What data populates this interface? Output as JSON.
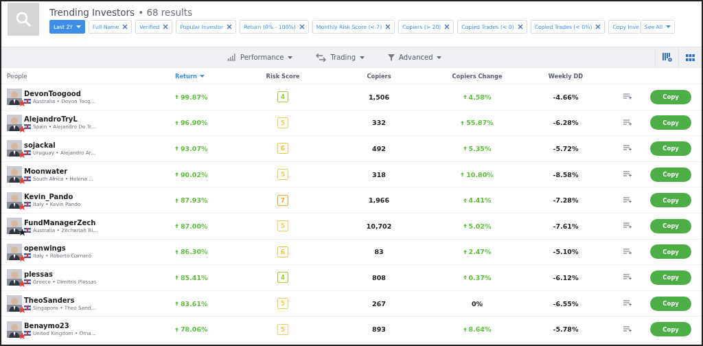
{
  "header": {
    "title": "Trending Investors",
    "count": "• 68 results"
  },
  "filters": [
    {
      "kind": "dropdown",
      "label": "Last 2Y",
      "selected": true
    },
    {
      "kind": "chip",
      "label": "Full Name"
    },
    {
      "kind": "chip",
      "label": "Verified"
    },
    {
      "kind": "chip",
      "label": "Popular Investor"
    },
    {
      "kind": "chip",
      "label": "Return (0% - 100%)"
    },
    {
      "kind": "chip",
      "label": "Monthly Risk Score (< 7)"
    },
    {
      "kind": "chip",
      "label": "Copiers (> 20)"
    },
    {
      "kind": "chip",
      "label": "Copied Trades (< 0)"
    },
    {
      "kind": "chip",
      "label": "Copied Trades (< 0%)"
    },
    {
      "kind": "cut",
      "label": "Copy Inve"
    },
    {
      "kind": "more",
      "label": "See All"
    }
  ],
  "toolbar": [
    {
      "kind": "chart",
      "label": "Performance"
    },
    {
      "kind": "swap",
      "label": "Trading"
    },
    {
      "kind": "filter",
      "label": "Advanced"
    }
  ],
  "table": {
    "columns": [
      {
        "label": "People",
        "sorted": false
      },
      {
        "label": "Return",
        "sorted": true
      },
      {
        "label": "Risk Score",
        "sorted": false
      },
      {
        "label": "Copiers",
        "sorted": false
      },
      {
        "label": "Copiers Change",
        "sorted": false
      },
      {
        "label": "Weekly DD",
        "sorted": false
      }
    ],
    "rows": [
      {
        "username": "DevonToogood",
        "subtitle": "Australia • Devon Toog...",
        "star": {
          "color": "#e53935"
        },
        "return": "99.87%",
        "risk": {
          "text": "4",
          "color": "#9ccc3c"
        },
        "copiers": "1,506",
        "change": {
          "kind": "up",
          "text": "4.58%"
        },
        "weekly_dd": "-4.66%",
        "action": "Copy"
      },
      {
        "username": "AlejandroTryL",
        "subtitle": "Spain • Alejandro De Tr...",
        "star": {
          "color": "#e53935"
        },
        "return": "96.90%",
        "risk": {
          "text": "5",
          "color": "#e9cf5a"
        },
        "copiers": "332",
        "change": {
          "kind": "up",
          "text": "55.87%"
        },
        "weekly_dd": "-6.28%",
        "action": "Copy"
      },
      {
        "username": "sojackal",
        "subtitle": "Uruguay • Alejandro Ar...",
        "star": {
          "color": "#e53935"
        },
        "return": "93.07%",
        "risk": {
          "text": "6",
          "color": "#f0c040"
        },
        "copiers": "492",
        "change": {
          "kind": "up",
          "text": "5.35%"
        },
        "weekly_dd": "-5.72%",
        "action": "Copy"
      },
      {
        "username": "Moonwater",
        "subtitle": "South Africa • Helena ...",
        "star": {
          "color": "#e53935"
        },
        "return": "90.02%",
        "risk": {
          "text": "5",
          "color": "#e9cf5a"
        },
        "copiers": "318",
        "change": {
          "kind": "up",
          "text": "10.80%"
        },
        "weekly_dd": "-8.58%",
        "action": "Copy"
      },
      {
        "username": "Kevin_Pando",
        "subtitle": "Italy • Kevin Pando",
        "star": {
          "color": "#e53935"
        },
        "return": "87.93%",
        "risk": {
          "text": "7",
          "color": "#f0a53a"
        },
        "copiers": "1,966",
        "change": {
          "kind": "up",
          "text": "4.41%"
        },
        "weekly_dd": "-7.28%",
        "action": "Copy"
      },
      {
        "username": "FundManagerZech",
        "subtitle": "Australia • Zechariah Bi...",
        "star": {
          "color": "#1a1a1a"
        },
        "return": "87.00%",
        "risk": {
          "text": "5",
          "color": "#e9cf5a"
        },
        "copiers": "10,702",
        "change": {
          "kind": "up",
          "text": "5.02%"
        },
        "weekly_dd": "-7.61%",
        "action": "Copy"
      },
      {
        "username": "openwings",
        "subtitle": "Italy • Roberto Garnero",
        "star": {
          "color": "#e53935"
        },
        "return": "86.30%",
        "risk": {
          "text": "6",
          "color": "#f0c040"
        },
        "copiers": "83",
        "change": {
          "kind": "up",
          "text": "2.47%"
        },
        "weekly_dd": "-5.10%",
        "action": "Copy"
      },
      {
        "username": "plessas",
        "subtitle": "Greece • Dimitris Plessas",
        "star": {
          "color": "#e53935"
        },
        "return": "85.41%",
        "risk": {
          "text": "4",
          "color": "#9ccc3c"
        },
        "copiers": "808",
        "change": {
          "kind": "up",
          "text": "0.37%"
        },
        "weekly_dd": "-6.12%",
        "action": "Copy"
      },
      {
        "username": "TheoSanders",
        "subtitle": "Singapore • Theo Sand...",
        "star": {
          "color": "#e53935"
        },
        "return": "83.61%",
        "risk": {
          "text": "5",
          "color": "#e9cf5a"
        },
        "copiers": "267",
        "change": {
          "kind": "flat",
          "text": "0%"
        },
        "weekly_dd": "-6.55%",
        "action": "Copy"
      },
      {
        "username": "Benaymo23",
        "subtitle": "United Kingdom • Oma...",
        "star": {
          "color": "#e53935"
        },
        "return": "78.06%",
        "risk": {
          "text": "5",
          "color": "#e9cf5a"
        },
        "copiers": "893",
        "change": {
          "kind": "up",
          "text": "8.64%"
        },
        "weekly_dd": "-5.78%",
        "action": "Copy"
      }
    ]
  }
}
